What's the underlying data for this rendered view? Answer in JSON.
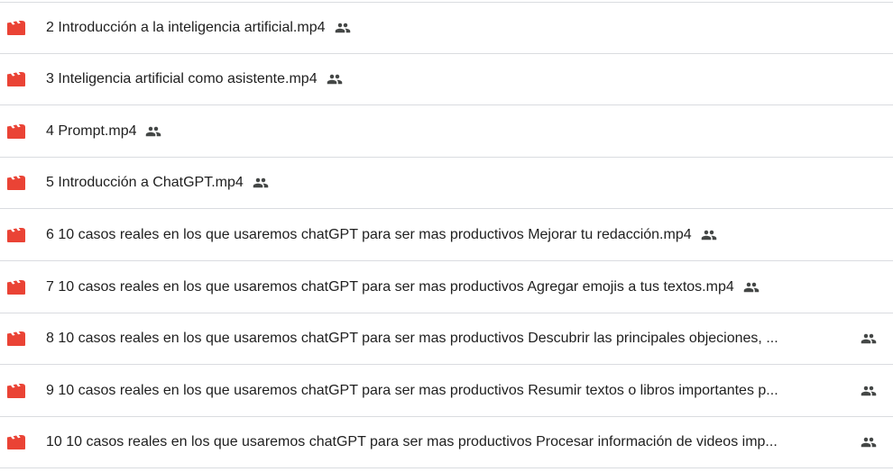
{
  "colors": {
    "video_icon": "#ea4335",
    "shared_icon": "#444746",
    "text": "#1f1f1f",
    "divider": "#dadce0"
  },
  "files": [
    {
      "name": "2 Introducción a la inteligencia artificial.mp4",
      "type_icon": "video-file-icon",
      "shared_icon": "people-icon"
    },
    {
      "name": "3 Inteligencia artificial como asistente.mp4",
      "type_icon": "video-file-icon",
      "shared_icon": "people-icon"
    },
    {
      "name": "4 Prompt.mp4",
      "type_icon": "video-file-icon",
      "shared_icon": "people-icon"
    },
    {
      "name": "5 Introducción a ChatGPT.mp4",
      "type_icon": "video-file-icon",
      "shared_icon": "people-icon"
    },
    {
      "name": "6 10 casos reales en los que usaremos chatGPT para ser mas productivos Mejorar tu redacción.mp4",
      "type_icon": "video-file-icon",
      "shared_icon": "people-icon"
    },
    {
      "name": "7 10 casos reales en los que usaremos chatGPT para ser mas productivos Agregar emojis a tus textos.mp4",
      "type_icon": "video-file-icon",
      "shared_icon": "people-icon"
    },
    {
      "name": "8 10 casos reales en los que usaremos chatGPT para ser mas productivos Descubrir las principales objeciones, ...",
      "type_icon": "video-file-icon",
      "shared_icon": "people-icon"
    },
    {
      "name": "9 10 casos reales en los que usaremos chatGPT para ser mas productivos Resumir textos o libros importantes p...",
      "type_icon": "video-file-icon",
      "shared_icon": "people-icon"
    },
    {
      "name": "10 10 casos reales en los que usaremos chatGPT para ser mas productivos Procesar información de videos imp...",
      "type_icon": "video-file-icon",
      "shared_icon": "people-icon"
    }
  ]
}
